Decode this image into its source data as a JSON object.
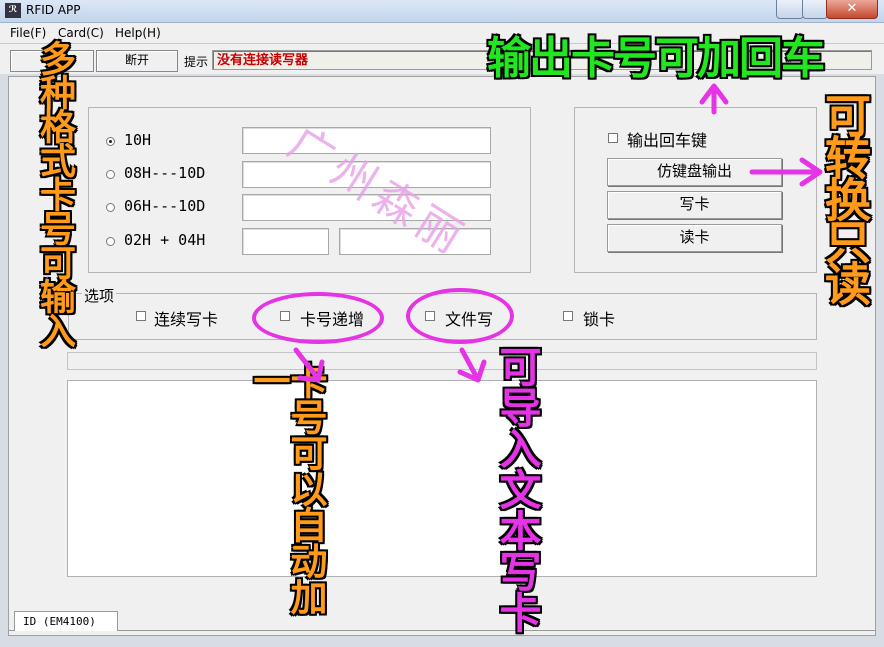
{
  "window": {
    "title": "RFID APP",
    "icon": "app-icon",
    "close_glyph": "✕"
  },
  "menu": [
    {
      "label": "File(F)"
    },
    {
      "label": "Card(C)"
    },
    {
      "label": "Help(H)"
    }
  ],
  "toolbar": {
    "connect_label": "连",
    "disconnect_label": "断开",
    "hint_label": "提示",
    "status_text": "没有连接读写器",
    "status_color": "#c80000"
  },
  "formats": [
    {
      "label": "10H",
      "selected": true
    },
    {
      "label": "08H---10D",
      "selected": false
    },
    {
      "label": "06H---10D",
      "selected": false
    },
    {
      "label": "02H + 04H",
      "selected": false
    }
  ],
  "output_panel": {
    "enter_key_label": "输出回车键",
    "emulate_keyboard_label": "仿键盘输出",
    "write_card_label": "写卡",
    "read_card_label": "读卡"
  },
  "options": {
    "group_label": "选项",
    "items": [
      {
        "label": "连续写卡"
      },
      {
        "label": "卡号递增"
      },
      {
        "label": "文件写"
      },
      {
        "label": "锁卡"
      }
    ]
  },
  "tab": {
    "label": "ID (EM4100)"
  },
  "watermark": "广州森丽",
  "annotations": {
    "top": "输出卡号可加回车",
    "left": "多种格式卡号可输入",
    "right": "可转换只读",
    "increment": "卡号可以自动加一",
    "import": "可导入文本写卡",
    "colors": {
      "green": "#22e61f",
      "orange": "#ff9a1a",
      "magenta": "#e533e6",
      "yellow": "#ffff33"
    }
  }
}
